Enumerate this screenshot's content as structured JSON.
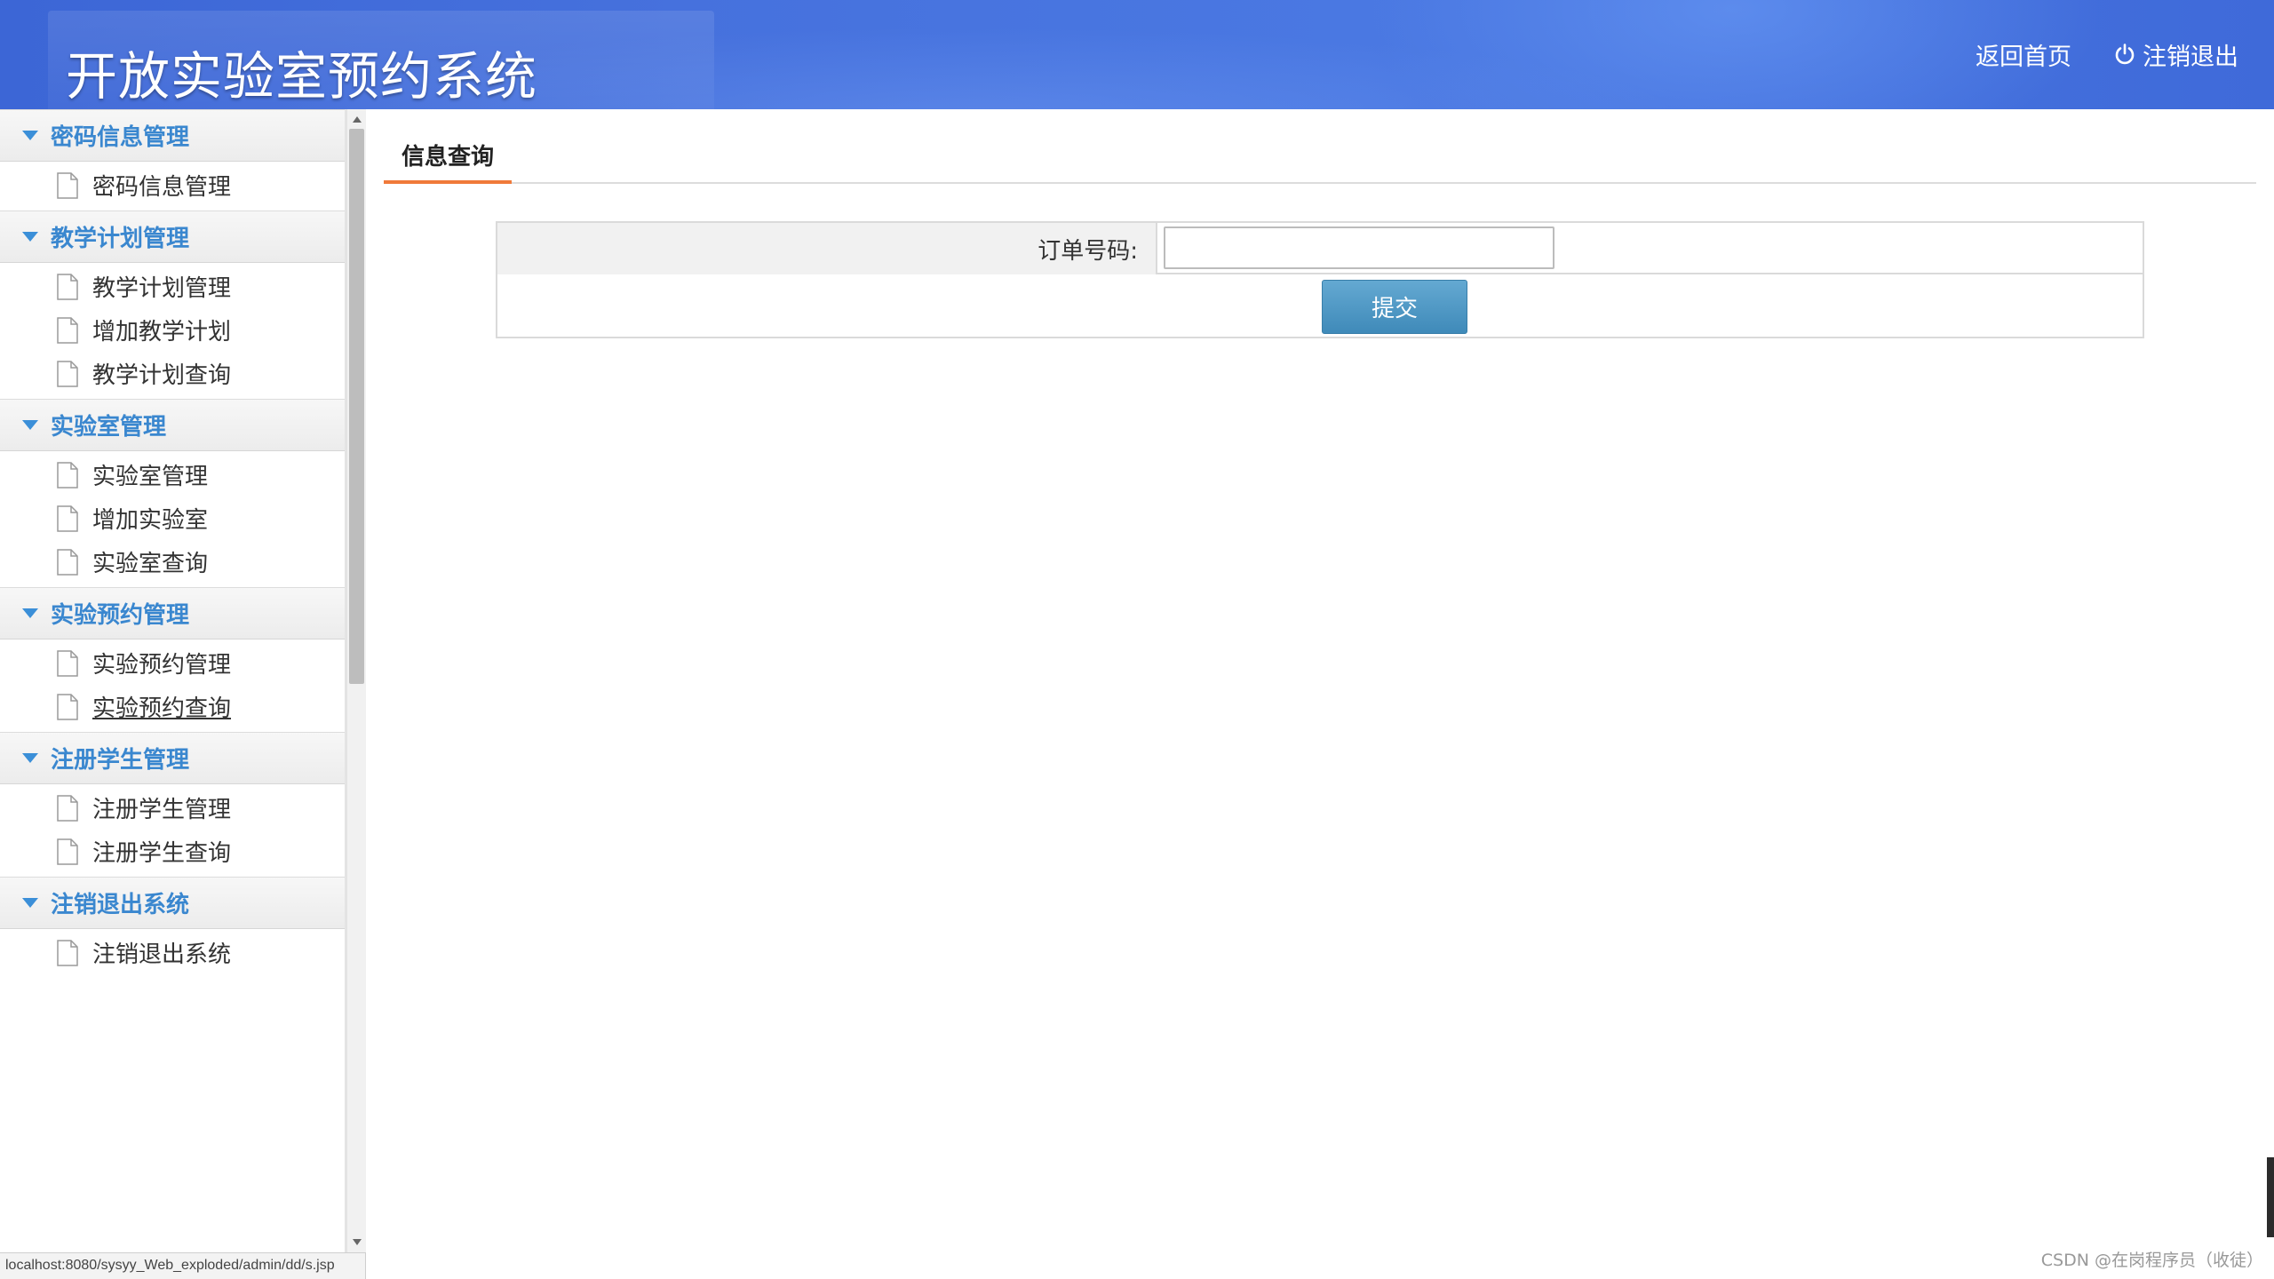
{
  "header": {
    "title": "开放实验室预约系统",
    "links": [
      {
        "label": "返回首页"
      },
      {
        "label": "注销退出",
        "icon": "power-icon"
      }
    ],
    "colors": {
      "bar": "#4671dd",
      "text": "#ffffff"
    }
  },
  "sidebar": {
    "groups": [
      {
        "label": "密码信息管理",
        "items": [
          {
            "label": "密码信息管理"
          }
        ]
      },
      {
        "label": "教学计划管理",
        "items": [
          {
            "label": "教学计划管理"
          },
          {
            "label": "增加教学计划"
          },
          {
            "label": "教学计划查询"
          }
        ]
      },
      {
        "label": "实验室管理",
        "items": [
          {
            "label": "实验室管理"
          },
          {
            "label": "增加实验室"
          },
          {
            "label": "实验室查询"
          }
        ]
      },
      {
        "label": "实验预约管理",
        "items": [
          {
            "label": "实验预约管理"
          },
          {
            "label": "实验预约查询"
          }
        ]
      },
      {
        "label": "注册学生管理",
        "items": [
          {
            "label": "注册学生管理"
          },
          {
            "label": "注册学生查询"
          }
        ]
      },
      {
        "label": "注销退出系统",
        "items": [
          {
            "label": "注销退出系统"
          }
        ]
      }
    ],
    "group_color": "#3a87cf"
  },
  "main": {
    "tab": "信息查询",
    "form": {
      "order_label": "订单号码:",
      "order_value": "",
      "submit_label": "提交"
    }
  },
  "statusbar": {
    "url": "localhost:8080/sysyy_Web_exploded/admin/dd/s.jsp"
  },
  "watermark": "CSDN @在岗程序员（收徒）"
}
